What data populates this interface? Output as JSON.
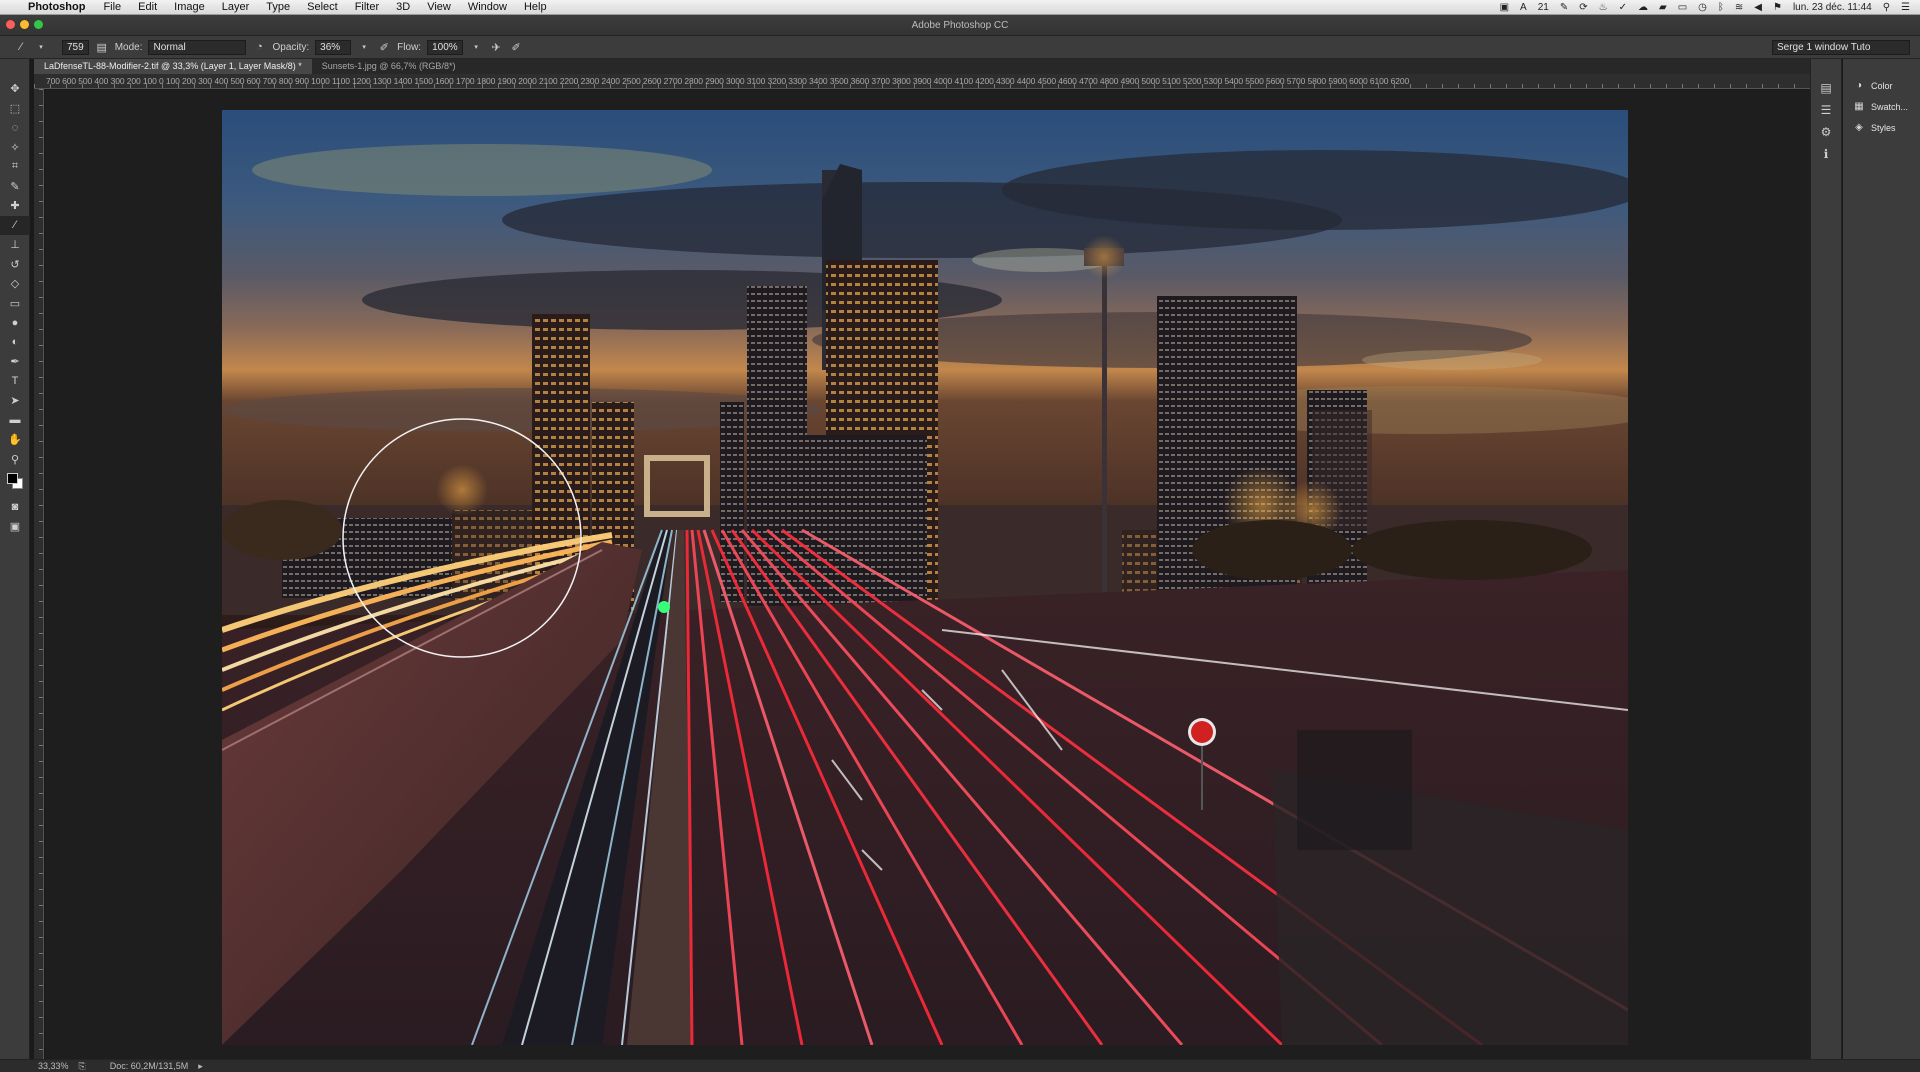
{
  "menubar": {
    "app_name": "Photoshop",
    "items": [
      "File",
      "Edit",
      "Image",
      "Layer",
      "Type",
      "Select",
      "Filter",
      "3D",
      "View",
      "Window",
      "Help"
    ],
    "status_text": "21",
    "datetime": "lun. 23 déc.  11:44"
  },
  "window": {
    "title": "Adobe Photoshop CC"
  },
  "options": {
    "brush_size": "759",
    "mode_label": "Mode:",
    "mode_value": "Normal",
    "opacity_label": "Opacity:",
    "opacity_value": "36%",
    "flow_label": "Flow:",
    "flow_value": "100%",
    "workspace": "Serge 1 window Tuto"
  },
  "tabs": [
    {
      "label": "LaDfenseTL-88-Modifier-2.tif @ 33,3% (Layer 1, Layer Mask/8) *",
      "active": true
    },
    {
      "label": "Sunsets-1.jpg @ 66,7% (RGB/8*)",
      "active": false
    }
  ],
  "ruler": {
    "labels": "700  600  500  400  300  200  100  0    100  200  300  400  500  600  700  800  900  1000 1100 1200 1300 1400 1500 1600 1700 1800 1900 2000 2100 2200 2300 2400 2500 2600 2700 2800 2900 3000 3100 3200 3300 3400 3500 3600 3700 3800 3900 4000 4100 4200 4300 4400 4500 4600 4700 4800 4900 5000 5100 5200 5300 5400 5500 5600 5700 5800 5900 6000 6100 6200"
  },
  "panels": [
    {
      "label": "Color",
      "icon": "color-wheel-icon"
    },
    {
      "label": "Swatch...",
      "icon": "swatches-icon"
    },
    {
      "label": "Styles",
      "icon": "styles-icon"
    }
  ],
  "status": {
    "zoom": "33,33%",
    "doc": "Doc: 60,2M/131,5M"
  },
  "colors": {
    "accent": "#1473e6",
    "foreground": "#000000",
    "background": "#ffffff"
  }
}
